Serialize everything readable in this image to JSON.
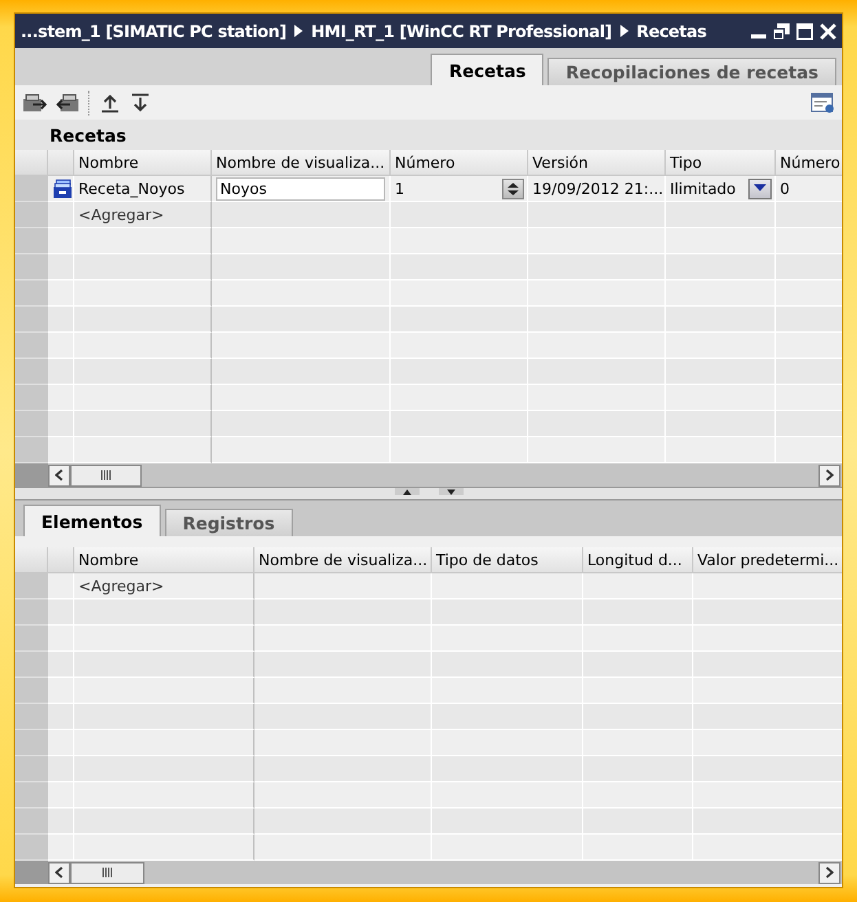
{
  "window": {
    "breadcrumb": [
      "...stem_1 [SIMATIC PC station]",
      "HMI_RT_1 [WinCC RT Professional]",
      "Recetas"
    ]
  },
  "tabs": [
    {
      "label": "Recetas",
      "selected": true
    },
    {
      "label": "Recopilaciones de recetas",
      "selected": false
    }
  ],
  "recipes_table": {
    "title": "Recetas",
    "columns": [
      "Nombre",
      "Nombre de visualiza...",
      "Número",
      "Versión",
      "Tipo",
      "Número"
    ],
    "rows": [
      {
        "kind": "recipe",
        "cells": [
          {
            "kind": "text",
            "value": "Receta_Noyos"
          },
          {
            "kind": "edit",
            "value": "Noyos"
          },
          {
            "kind": "spinner",
            "value": "1"
          },
          {
            "kind": "text",
            "value": "19/09/2012 21:..."
          },
          {
            "kind": "dropdown",
            "value": "Ilimitado"
          },
          {
            "kind": "text",
            "value": "0"
          }
        ]
      },
      {
        "kind": "add",
        "cells": [
          {
            "kind": "text",
            "value": "<Agregar>"
          }
        ]
      }
    ]
  },
  "bottom_tabs": [
    {
      "label": "Elementos",
      "selected": true
    },
    {
      "label": "Registros",
      "selected": false
    }
  ],
  "elements_table": {
    "columns": [
      "Nombre",
      "Nombre de visualiza...",
      "Tipo de datos",
      "Longitud d...",
      "Valor predetermi..."
    ],
    "rows": [
      {
        "kind": "add",
        "cells": [
          {
            "kind": "text",
            "value": "<Agregar>"
          }
        ]
      }
    ]
  }
}
